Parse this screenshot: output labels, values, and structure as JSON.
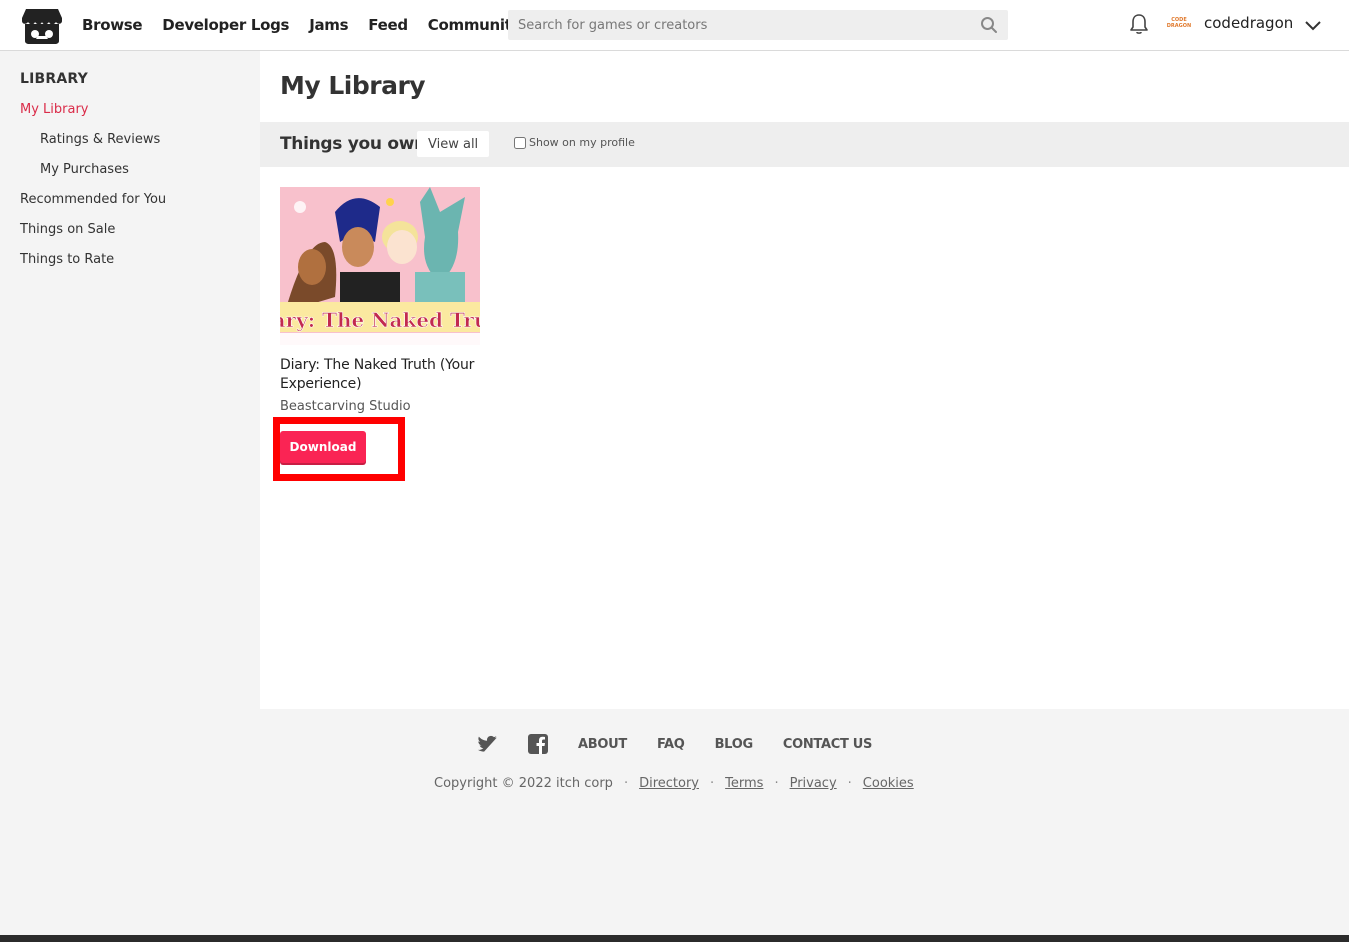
{
  "header": {
    "nav": [
      "Browse",
      "Developer Logs",
      "Jams",
      "Feed",
      "Community"
    ],
    "search_placeholder": "Search for games or creators",
    "username": "codedragon",
    "avatar_text": "CODE DRAGON"
  },
  "sidebar": {
    "title": "LIBRARY",
    "items": [
      {
        "label": "My Library",
        "active": true
      },
      {
        "label": "Ratings & Reviews"
      },
      {
        "label": "My Purchases"
      },
      {
        "label": "Recommended for You"
      },
      {
        "label": "Things on Sale"
      },
      {
        "label": "Things to Rate"
      }
    ]
  },
  "main": {
    "title": "My Library",
    "section_title": "Things you own",
    "view_all_label": "View all",
    "show_profile_label": "Show on my profile",
    "game": {
      "title": "Diary: The Naked Truth (Your Experience)",
      "author": "Beastcarving Studio",
      "download_label": "Download",
      "thumb_text": "Diary: The Naked Truth"
    }
  },
  "footer": {
    "links": [
      "ABOUT",
      "FAQ",
      "BLOG",
      "CONTACT US"
    ],
    "copyright": "Copyright © 2022 itch corp",
    "legal_links": [
      "Directory",
      "Terms",
      "Privacy",
      "Cookies"
    ],
    "dot": "·"
  },
  "colors": {
    "accent": "#da2c49",
    "download_button": "#fa2454",
    "highlight": "#ff0000"
  }
}
